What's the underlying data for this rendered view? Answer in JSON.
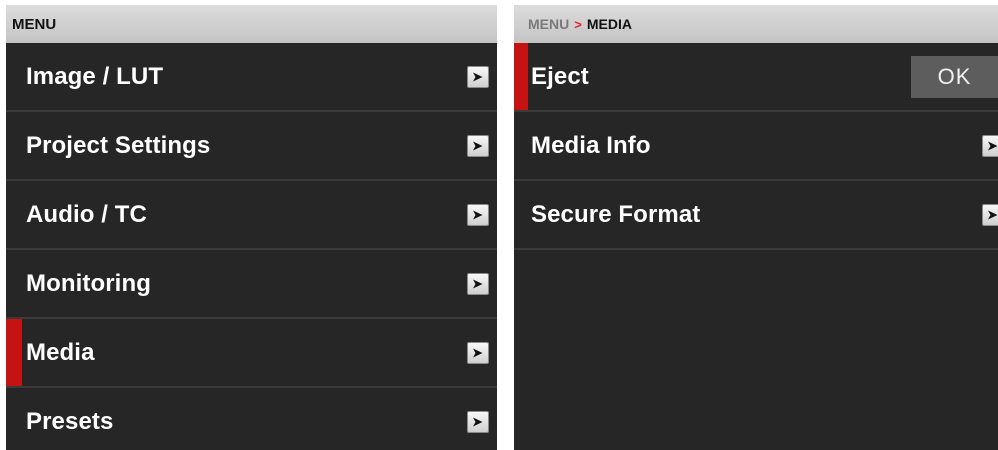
{
  "left_panel": {
    "header": "MENU",
    "items": [
      {
        "label": "Image / LUT",
        "active": false
      },
      {
        "label": "Project Settings",
        "active": false
      },
      {
        "label": "Audio / TC",
        "active": false
      },
      {
        "label": "Monitoring",
        "active": false
      },
      {
        "label": "Media",
        "active": true
      },
      {
        "label": "Presets",
        "active": false
      }
    ]
  },
  "right_panel": {
    "breadcrumb": {
      "root": "MENU",
      "separator": ">",
      "current": "MEDIA"
    },
    "items": [
      {
        "label": "Eject",
        "active": true,
        "action": "OK"
      },
      {
        "label": "Media Info",
        "active": false
      },
      {
        "label": "Secure Format",
        "active": false
      }
    ]
  },
  "colors": {
    "panel_background": "#262626",
    "header_background": "#d0d0d0",
    "active_indicator": "#c51212",
    "breadcrumb_separator": "#e0242c",
    "ok_button": "#5d5d5d"
  },
  "icons": {
    "submenu_arrow": "chevron-right-icon"
  }
}
